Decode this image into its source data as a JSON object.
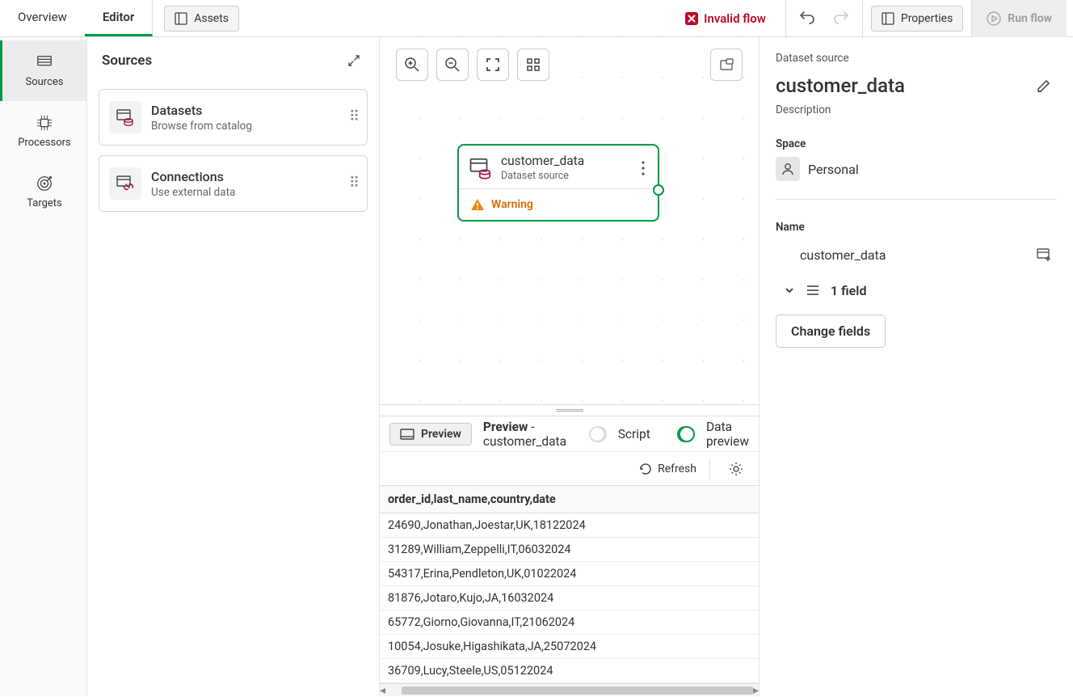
{
  "topbar": {
    "tabs": {
      "overview": "Overview",
      "editor": "Editor"
    },
    "assets_label": "Assets",
    "invalid_label": "Invalid flow",
    "properties_label": "Properties",
    "run_flow_label": "Run flow"
  },
  "rail": {
    "sources": "Sources",
    "processors": "Processors",
    "targets": "Targets"
  },
  "sources_panel": {
    "title": "Sources",
    "cards": {
      "datasets": {
        "title": "Datasets",
        "sub": "Browse from catalog"
      },
      "connections": {
        "title": "Connections",
        "sub": "Use external data"
      }
    }
  },
  "node": {
    "title": "customer_data",
    "subtitle": "Dataset source",
    "warning_label": "Warning"
  },
  "preview": {
    "chip_label": "Preview",
    "title_prefix": "Preview",
    "title_dataset": "customer_data",
    "script_label": "Script",
    "datapreview_label": "Data preview",
    "refresh_label": "Refresh",
    "header": "order_id,last_name,country,date",
    "rows": [
      "24690,Jonathan,Joestar,UK,18122024",
      "31289,William,Zeppelli,IT,06032024",
      "54317,Erina,Pendleton,UK,01022024",
      "81876,Jotaro,Kujo,JA,16032024",
      "65772,Giorno,Giovanna,IT,21062024",
      "10054,Josuke,Higashikata,JA,25072024",
      "36709,Lucy,Steele,US,05122024"
    ]
  },
  "right": {
    "pretitle": "Dataset source",
    "title": "customer_data",
    "desc_label": "Description",
    "space_label": "Space",
    "space_value": "Personal",
    "name_label": "Name",
    "name_value": "customer_data",
    "fields_label": "1 field",
    "change_fields_label": "Change fields"
  }
}
